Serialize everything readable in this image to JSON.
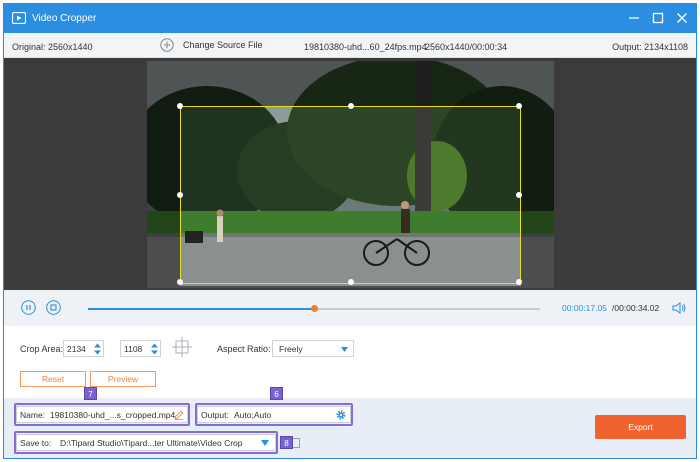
{
  "window": {
    "title": "Video Cropper"
  },
  "info": {
    "original": "Original: 2560x1440",
    "change_source": "Change Source File",
    "file_name": "19810380-uhd...60_24fps.mp4",
    "file_meta": "2560x1440/00:00:34",
    "output": "Output: 2134x1108"
  },
  "playback": {
    "current_time": "00:00:17.05",
    "total_time": "/00:00:34.02",
    "progress": 0.5
  },
  "crop": {
    "area_label": "Crop Area:",
    "width": "2134",
    "height": "1108",
    "aspect_label": "Aspect Ratio:",
    "aspect_value": "Freely",
    "reset_label": "Reset",
    "preview_label": "Preview"
  },
  "output_settings": {
    "name_label": "Name:",
    "name_value": "19810380-uhd_...s_cropped.mp4",
    "output_label": "Output:",
    "output_value": "Auto;Auto",
    "save_label": "Save to:",
    "save_value": "D:\\Tipard Studio\\Tipard...ter Ultimate\\Video Crop",
    "export_label": "Export"
  },
  "badges": {
    "name": "7",
    "output": "6",
    "save": "8"
  },
  "colors": {
    "accent": "#2b8ee0",
    "export": "#f0622e",
    "crop_border": "#e6dd24",
    "badge": "#7a63d0"
  }
}
